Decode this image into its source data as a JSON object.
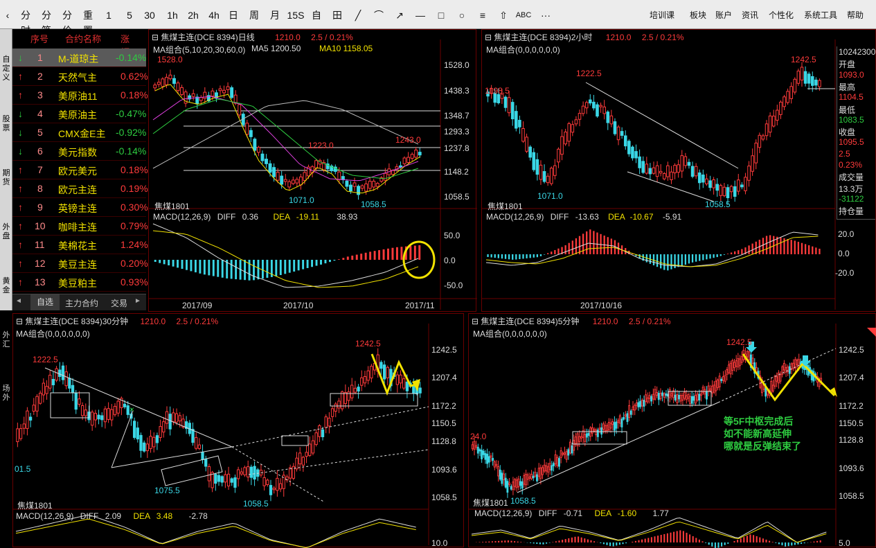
{
  "toolbar": {
    "icons": [
      "分时",
      "分笔",
      "分价",
      "重置",
      "1",
      "5",
      "30",
      "1h",
      "2h",
      "4h",
      "日",
      "周",
      "月",
      "15S",
      "自",
      "田",
      "╱",
      "⌒",
      "↗",
      "—",
      "□",
      "○",
      "≡",
      "⇧",
      "ABC",
      "···"
    ],
    "menus": [
      "培训课",
      "板块",
      "账户",
      "资讯",
      "个性化",
      "系统工具",
      "帮助"
    ]
  },
  "left_tabs": [
    "自定义",
    "股票",
    "期货",
    "外盘",
    "黄金",
    "外汇",
    "场外"
  ],
  "watchlist": {
    "headers": [
      "序号",
      "合约名称",
      "涨幅%"
    ],
    "rows": [
      {
        "dir": "down",
        "no": "1",
        "name": "M-道琼主",
        "chg": "-0.14%"
      },
      {
        "dir": "up",
        "no": "2",
        "name": "天然气主",
        "chg": "0.62%"
      },
      {
        "dir": "up",
        "no": "3",
        "name": "美原油11",
        "chg": "0.18%"
      },
      {
        "dir": "down",
        "no": "4",
        "name": "美原油主",
        "chg": "-0.47%"
      },
      {
        "dir": "down",
        "no": "5",
        "name": "CMX金E主",
        "chg": "-0.92%"
      },
      {
        "dir": "down",
        "no": "6",
        "name": "美元指数",
        "chg": "-0.14%"
      },
      {
        "dir": "up",
        "no": "7",
        "name": "欧元美元",
        "chg": "0.18%"
      },
      {
        "dir": "up",
        "no": "8",
        "name": "欧元主连",
        "chg": "0.19%"
      },
      {
        "dir": "up",
        "no": "9",
        "name": "英镑主连",
        "chg": "0.30%"
      },
      {
        "dir": "up",
        "no": "10",
        "name": "咖啡主连",
        "chg": "0.79%"
      },
      {
        "dir": "up",
        "no": "11",
        "name": "美棉花主",
        "chg": "1.24%"
      },
      {
        "dir": "up",
        "no": "12",
        "name": "美豆主连",
        "chg": "0.20%"
      },
      {
        "dir": "up",
        "no": "13",
        "name": "美豆粕主",
        "chg": "0.93%"
      }
    ],
    "tabs": [
      "自选",
      "主力合约",
      "交易"
    ],
    "nav_left": "◄",
    "nav_right": "►"
  },
  "chart_daily": {
    "title": "焦煤主连(DCE 8394)日线",
    "price": "1210.0",
    "change": "2.5 / 0.21%",
    "ma_label": "MA组合(5,10,20,30,60,0)",
    "ma5": "MA5 1200.50",
    "ma10": "MA10 1158.05",
    "y_ticks": [
      "1528.0",
      "1438.3",
      "1348.7",
      "1293.3",
      "1237.8",
      "1148.2",
      "1058.5"
    ],
    "annotations": [
      "1528.0",
      "1223.0",
      "1243.0",
      "1071.0",
      "1058.5"
    ],
    "symbol": "焦煤1801",
    "macd_label": "MACD(12,26,9)",
    "diff_label": "DIFF",
    "diff": "0.36",
    "dea_label": "DEA",
    "dea": "-19.11",
    "macd_val": "38.93",
    "macd_ticks": [
      "50.0",
      "0.0",
      "-50.0"
    ],
    "x_ticks": [
      "2017/09",
      "2017/10",
      "2017/11"
    ]
  },
  "chart_2h": {
    "title": "焦煤主连(DCE 8394)2小时",
    "price": "1210.0",
    "change": "2.5 / 0.21%",
    "ma_label": "MA组合(0,0,0,0,0,0)",
    "annotations": [
      "1222.5",
      "1242.5",
      "1198.5",
      "1071.0",
      "1058.5"
    ],
    "symbol": "焦煤1801",
    "macd_label": "MACD(12,26,9)",
    "diff_label": "DIFF",
    "diff": "-13.63",
    "dea_label": "DEA",
    "dea": "-10.67",
    "macd_val": "-5.91",
    "macd_ticks": [
      "20.0",
      "0.0",
      "-20.0"
    ],
    "x_ticks": [
      "2017/10/16"
    ],
    "side": [
      {
        "t": "10242300",
        "c": "w"
      },
      {
        "t": "开盘",
        "c": "w"
      },
      {
        "t": "1093.0",
        "c": "r"
      },
      {
        "t": "最高",
        "c": "w"
      },
      {
        "t": "1104.5",
        "c": "r"
      },
      {
        "t": "最低",
        "c": "w"
      },
      {
        "t": "1083.5",
        "c": "g"
      },
      {
        "t": "收盘",
        "c": "w"
      },
      {
        "t": "1095.5",
        "c": "r"
      },
      {
        "t": "2.5",
        "c": "r"
      },
      {
        "t": "0.23%",
        "c": "r"
      },
      {
        "t": "成交量",
        "c": "w"
      },
      {
        "t": "13.3万",
        "c": "w"
      },
      {
        "t": "-31122",
        "c": "g"
      },
      {
        "t": "持仓量",
        "c": "w"
      }
    ]
  },
  "chart_30m": {
    "title": "焦煤主连(DCE 8394)30分钟",
    "price": "1210.0",
    "change": "2.5 / 0.21%",
    "ma_label": "MA组合(0,0,0,0,0,0)",
    "y_ticks": [
      "1242.5",
      "1207.4",
      "1172.2",
      "1150.5",
      "1128.8",
      "1093.6",
      "1058.5"
    ],
    "annotations": [
      "1222.5",
      "1242.5",
      "1075.5",
      "1058.5",
      "01.5"
    ],
    "symbol": "焦煤1801",
    "macd_label": "MACD(12,26,9)",
    "diff_label": "DIFF",
    "diff": "2.09",
    "dea_label": "DEA",
    "dea": "3.48",
    "macd_val": "-2.78",
    "macd_ticks": [
      "10.0"
    ]
  },
  "chart_5m": {
    "title": "焦煤主连(DCE 8394)5分钟",
    "price": "1210.0",
    "change": "2.5 / 0.21%",
    "ma_label": "MA组合(0,0,0,0,0,0)",
    "y_ticks": [
      "1242.5",
      "1207.4",
      "1172.2",
      "1150.5",
      "1128.8",
      "1093.6",
      "1058.5"
    ],
    "annotations": [
      "1242.5",
      "24.0",
      "1058.5"
    ],
    "note": [
      "等5F中枢完成后",
      "如不能新高延伸",
      "哪就是反弹结束了"
    ],
    "symbol": "焦煤1801",
    "macd_label": "MACD(12,26,9)",
    "diff_label": "DIFF",
    "diff": "-0.71",
    "dea_label": "DEA",
    "dea": "-1.60",
    "macd_val": "1.77",
    "macd_ticks": [
      "5.0"
    ]
  },
  "colors": {
    "up": "#ff3b3b",
    "down": "#3ad7e6",
    "text": "#dddddd",
    "accent": "#f2e200",
    "note": "#2ecc40",
    "frame": "#6a0000"
  }
}
